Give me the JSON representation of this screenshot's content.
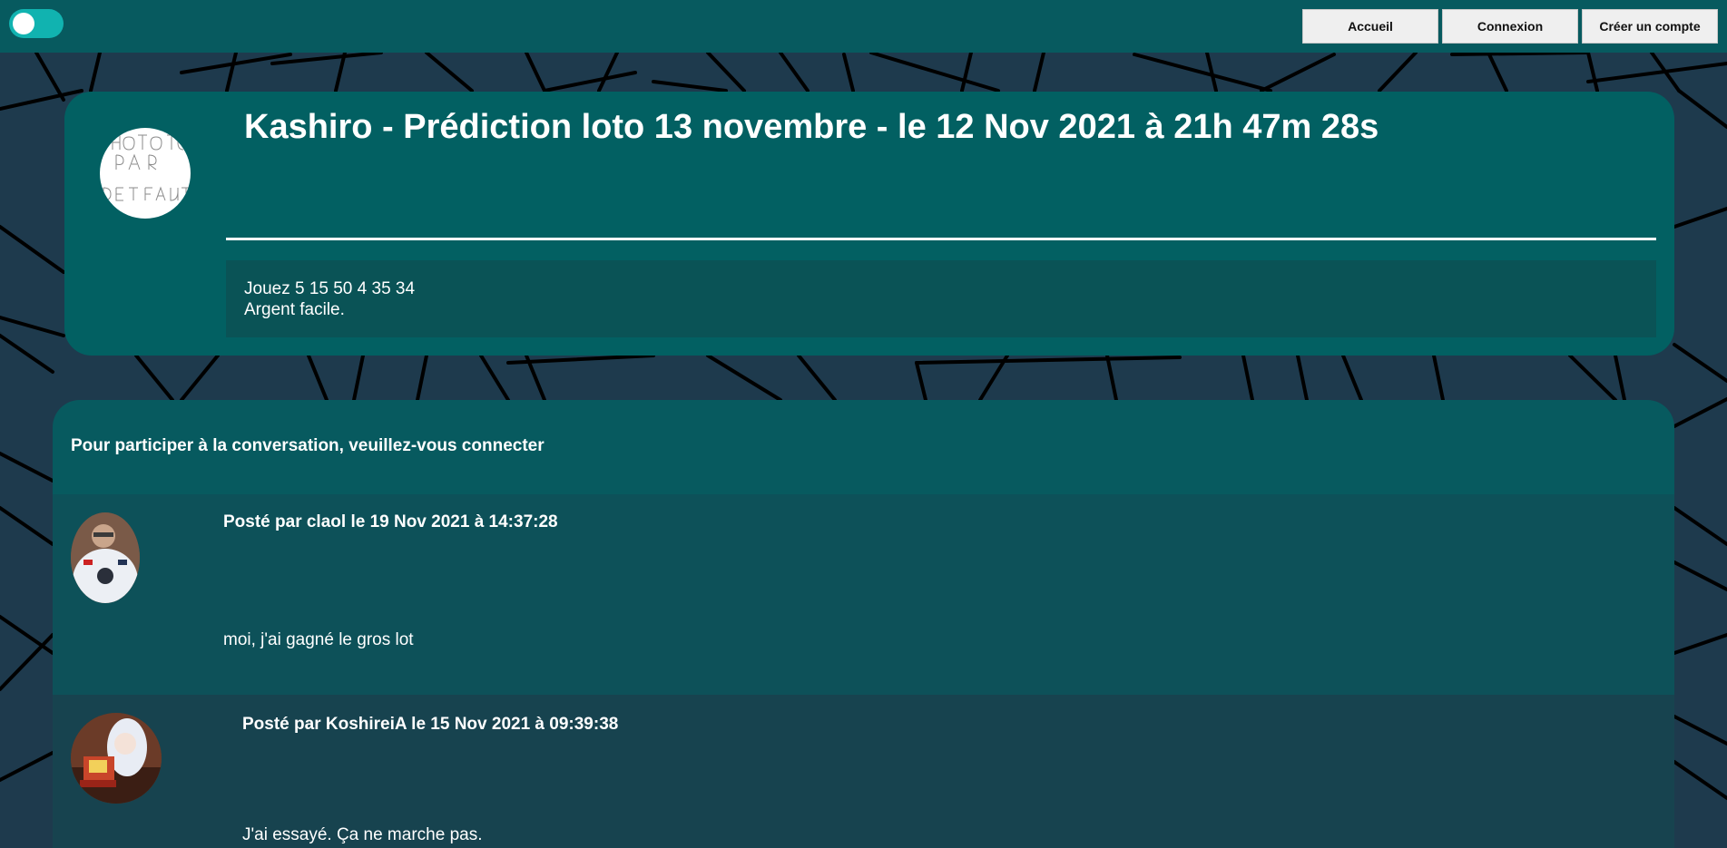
{
  "navbar": {
    "theme_toggle": "on",
    "buttons": [
      "Accueil",
      "Connexion",
      "Créer un compte"
    ]
  },
  "post": {
    "title": "Kashiro - Prédiction loto 13 novembre - le 12 Nov 2021 à 21h 47m 28s",
    "avatar_text": [
      "PHOTO",
      "PAR",
      "DEFAUT"
    ],
    "body_lines": [
      "Jouez 5 15 50 4 35 34",
      "Argent facile."
    ]
  },
  "conversation": {
    "connect_message": "Pour participer à la conversation, veuillez-vous connecter",
    "comments": [
      {
        "meta": "Posté par claol le 19 Nov 2021 à 14:37:28",
        "text": "moi, j'ai gagné le gros lot"
      },
      {
        "meta": "Posté par KoshireiA le 15 Nov 2021 à 09:39:38",
        "text": "J'ai essayé. Ça ne marche pas."
      }
    ]
  },
  "colors": {
    "page_bg": "#1e3a4d",
    "navbar_bg": "#075a5f",
    "toggle_bg": "#11b3b0",
    "post_card_bg": "#026062",
    "post_body_bg": "#0a5356",
    "comment_odd_bg": "#0d5159",
    "comment_even_bg": "#17434f"
  }
}
